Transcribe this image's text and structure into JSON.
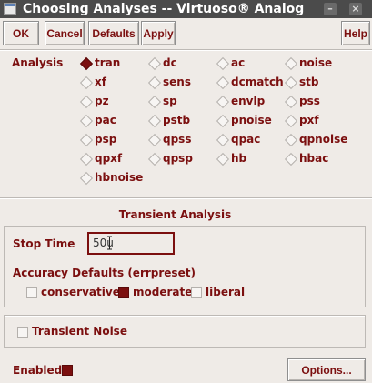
{
  "window": {
    "title": "Choosing Analyses -- Virtuoso® Analog De",
    "min_glyph": "–",
    "close_glyph": "×"
  },
  "toolbar": {
    "ok": "OK",
    "cancel": "Cancel",
    "defaults": "Defaults",
    "apply": "Apply",
    "help": "Help"
  },
  "analysis": {
    "label": "Analysis",
    "selected": "tran",
    "options": [
      "tran",
      "dc",
      "ac",
      "noise",
      "xf",
      "sens",
      "dcmatch",
      "stb",
      "pz",
      "sp",
      "envlp",
      "pss",
      "pac",
      "pstb",
      "pnoise",
      "pxf",
      "psp",
      "qpss",
      "qpac",
      "qpnoise",
      "qpxf",
      "qpsp",
      "hb",
      "hbac",
      "hbnoise"
    ]
  },
  "transient": {
    "section_title": "Transient Analysis",
    "stop_time_label": "Stop Time",
    "stop_time_value": "50u",
    "accuracy_label": "Accuracy Defaults (errpreset)",
    "accuracy_options": [
      "conservative",
      "moderate",
      "liberal"
    ],
    "accuracy_selected": "moderate",
    "noise_label": "Transient Noise",
    "noise_checked": false
  },
  "footer": {
    "enabled_label": "Enabled",
    "enabled_checked": true,
    "options_button": "Options..."
  },
  "colors": {
    "accent": "#7b0f0f",
    "background": "#efebe7",
    "titlebar": "#4b4b4b"
  }
}
